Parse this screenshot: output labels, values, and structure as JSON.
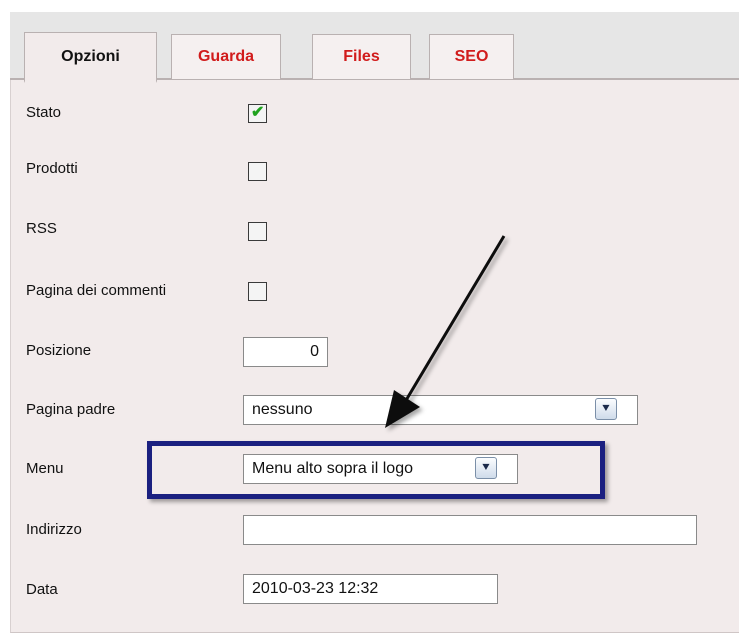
{
  "tabs": [
    {
      "label": "Opzioni",
      "active": true
    },
    {
      "label": "Guarda",
      "active": false
    },
    {
      "label": "Files",
      "active": false
    },
    {
      "label": "SEO",
      "active": false
    }
  ],
  "form": {
    "stato": {
      "label": "Stato",
      "checked": true
    },
    "prodotti": {
      "label": "Prodotti",
      "checked": false
    },
    "rss": {
      "label": "RSS",
      "checked": false
    },
    "pagina_commenti": {
      "label": "Pagina dei commenti",
      "checked": false
    },
    "posizione": {
      "label": "Posizione",
      "value": "0"
    },
    "pagina_padre": {
      "label": "Pagina padre",
      "value": "nessuno"
    },
    "menu": {
      "label": "Menu",
      "value": "Menu alto sopra il logo"
    },
    "indirizzo": {
      "label": "Indirizzo",
      "value": ""
    },
    "data": {
      "label": "Data",
      "value": "2010-03-23 12:32"
    }
  },
  "icons": {
    "checkmark": "✔",
    "dropdown": "chevron-down-icon"
  },
  "colors": {
    "tab_inactive_text": "#d11c1c",
    "panel_bg": "#f2ebeb",
    "highlight_box": "#1b2080",
    "check_green": "#1fa31f"
  }
}
